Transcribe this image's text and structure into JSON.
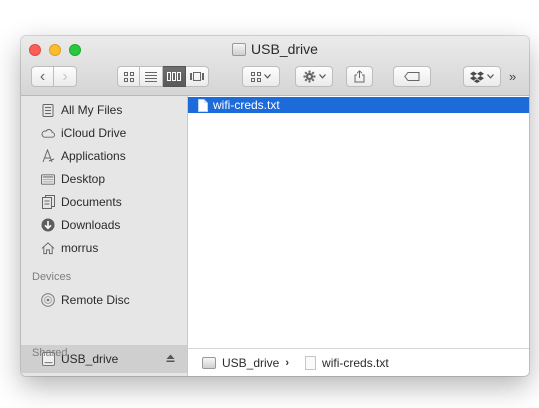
{
  "window": {
    "title": "USB_drive"
  },
  "toolbar": {
    "back_glyph": "‹",
    "forward_glyph": "›",
    "more_glyph": "»",
    "icons": [
      "icon-view-icon",
      "list-view-icon",
      "column-view-icon",
      "coverflow-view-icon",
      "arrange-icon",
      "gear-icon",
      "share-icon",
      "tag-icon",
      "dropbox-icon"
    ],
    "active_view": "column-view"
  },
  "sidebar": {
    "favorites": [
      {
        "label": "All My Files",
        "icon": "all-files-icon"
      },
      {
        "label": "iCloud Drive",
        "icon": "cloud-icon"
      },
      {
        "label": "Applications",
        "icon": "applications-icon"
      },
      {
        "label": "Desktop",
        "icon": "desktop-icon"
      },
      {
        "label": "Documents",
        "icon": "documents-icon"
      },
      {
        "label": "Downloads",
        "icon": "downloads-icon"
      },
      {
        "label": "morrus",
        "icon": "home-icon"
      }
    ],
    "devices_header": "Devices",
    "devices": [
      {
        "label": "Remote Disc",
        "icon": "disc-icon"
      },
      {
        "label": "USB_drive",
        "icon": "drive-icon",
        "selected": true
      }
    ],
    "shared_header": "Shared"
  },
  "content": {
    "files": [
      {
        "name": "wifi-creds.txt",
        "selected": true
      }
    ]
  },
  "pathbar": {
    "items": [
      "USB_drive",
      "wifi-creds.txt"
    ],
    "separator": "›"
  },
  "colors": {
    "selection": "#1d6ad9",
    "sidebar_bg": "#e6e6e6",
    "close": "#fc5f57",
    "minimize": "#fdbc2e",
    "maximize": "#28c840"
  }
}
